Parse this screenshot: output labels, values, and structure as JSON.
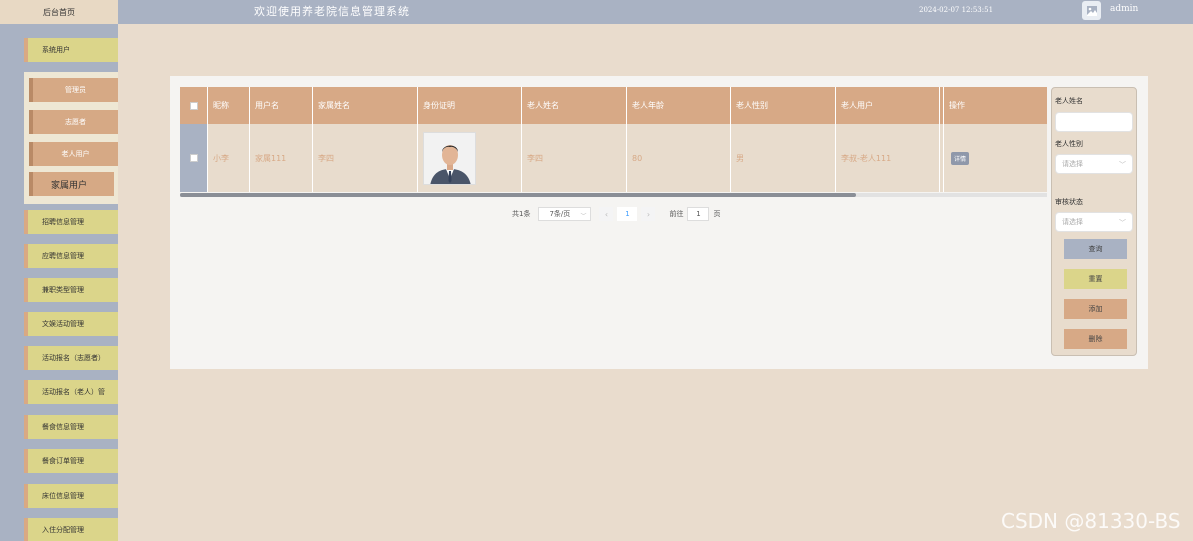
{
  "header": {
    "home_label": "后台首页",
    "title": "欢迎使用养老院信息管理系统",
    "datetime": "2024-02-07 12:53:51",
    "username": "admin"
  },
  "sidebar": {
    "items": [
      {
        "label": "系统用户"
      },
      {
        "label": "招聘信息管理"
      },
      {
        "label": "应聘信息管理"
      },
      {
        "label": "兼职类型管理"
      },
      {
        "label": "文娱活动管理"
      },
      {
        "label": "活动报名（志愿者）"
      },
      {
        "label": "活动报名（老人）管"
      },
      {
        "label": "餐食信息管理"
      },
      {
        "label": "餐食订单管理"
      },
      {
        "label": "床位信息管理"
      },
      {
        "label": "入住分配管理"
      }
    ],
    "submenu": [
      {
        "label": "管理员"
      },
      {
        "label": "志愿者"
      },
      {
        "label": "老人用户"
      },
      {
        "label": "家属用户"
      }
    ]
  },
  "table": {
    "headers": [
      "昵称",
      "用户名",
      "家属姓名",
      "身份证明",
      "老人姓名",
      "老人年龄",
      "老人性别",
      "老人用户",
      "操作"
    ],
    "rows": [
      {
        "nickname": "小李",
        "username": "家属111",
        "family_name": "李四",
        "elder_name": "李四",
        "elder_age": "80",
        "elder_gender": "男",
        "elder_user": "李叔-老人111",
        "action": "详情"
      }
    ]
  },
  "pagination": {
    "total": "共1条",
    "page_size": "7条/页",
    "current_page": "1",
    "goto_prefix": "前往",
    "goto_value": "1",
    "goto_suffix": "页"
  },
  "search": {
    "elder_name_label": "老人姓名",
    "elder_gender_label": "老人性别",
    "elder_gender_placeholder": "请选择",
    "review_label": "审核状态",
    "review_placeholder": "请选择",
    "query_btn": "查询",
    "reset_btn": "重置",
    "add_btn": "添加",
    "delete_btn": "删除"
  },
  "watermark": "CSDN @81330-BS",
  "colors": {
    "background": "#e9dccd",
    "topbar": "#a9b2c3",
    "accent_tan": "#d7a986",
    "accent_yellow": "#dbd58a"
  }
}
